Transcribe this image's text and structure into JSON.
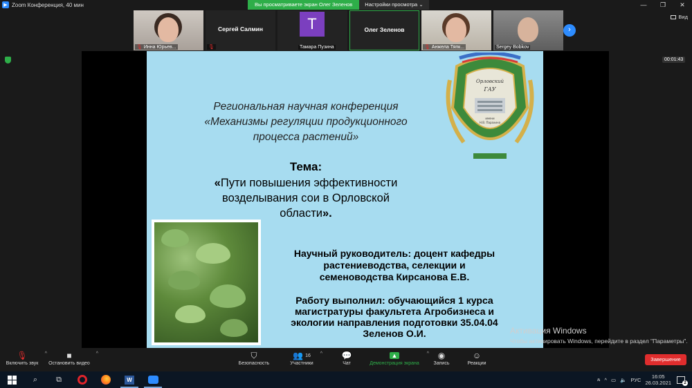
{
  "window": {
    "title": "Zoom Конференция, 40 мин"
  },
  "banner": {
    "viewing": "Вы просматриваете экран Олег Зеленов",
    "view_options": "Настройки просмотра"
  },
  "thumbnails": [
    {
      "name": "Инна Юрьев...",
      "muted": true,
      "video": true
    },
    {
      "name": "Сергей Салмин",
      "muted": true,
      "video": false
    },
    {
      "name": "Тамара Пузина",
      "avatar_letter": "T",
      "muted": false,
      "video": false
    },
    {
      "name": "Олег Зеленов",
      "muted": false,
      "video": false,
      "active": true
    },
    {
      "name": "Анжела Тяпк...",
      "muted": true,
      "video": true
    },
    {
      "name": "Sergey Bobkov",
      "muted": false,
      "video": true
    }
  ],
  "view_button": "Вид",
  "timer": "00:01:43",
  "slide": {
    "conference": [
      "Региональная научная конференция",
      "«Механизмы регуляции продукционного",
      "процесса растений»"
    ],
    "tema_label": "Тема:",
    "topic_open": "«",
    "topic_lines": [
      "Пути повышения эффективности",
      "возделывания сои в Орловской",
      "области"
    ],
    "topic_close": "».",
    "emblem_text": [
      "Орловский",
      "ГАУ",
      "имени",
      "Н.В. Парахина"
    ],
    "supervisor": [
      "Научный руководитель: доцент кафедры",
      "растениеводства, селекции и",
      "семеноводства Кирсанова Е.В."
    ],
    "author": [
      "Работу выполнил: обучающийся 1 курса",
      "магистратуры факультета Агробизнеса и",
      "экологии направления подготовки 35.04.04",
      "Зеленов О.И."
    ]
  },
  "activation": {
    "title": "Активация Windows",
    "text": "Чтобы активировать Windows, перейдите в раздел \"Параметры\"."
  },
  "toolbar": {
    "unmute": "Включить звук",
    "stop_video": "Остановить видео",
    "security": "Безопасность",
    "participants": "Участники",
    "participants_count": "16",
    "chat": "Чат",
    "share": "Демонстрация экрана",
    "record": "Запись",
    "reactions": "Реакции",
    "end": "Завершение"
  },
  "taskbar": {
    "lang": "РУС",
    "time": "16:05",
    "date": "26.03.2021",
    "notifications": "2"
  },
  "colors": {
    "zoom_blue": "#2d8cff",
    "green": "#2eae49",
    "end_red": "#e02d2d",
    "slide_bg": "#a7dcf0"
  }
}
